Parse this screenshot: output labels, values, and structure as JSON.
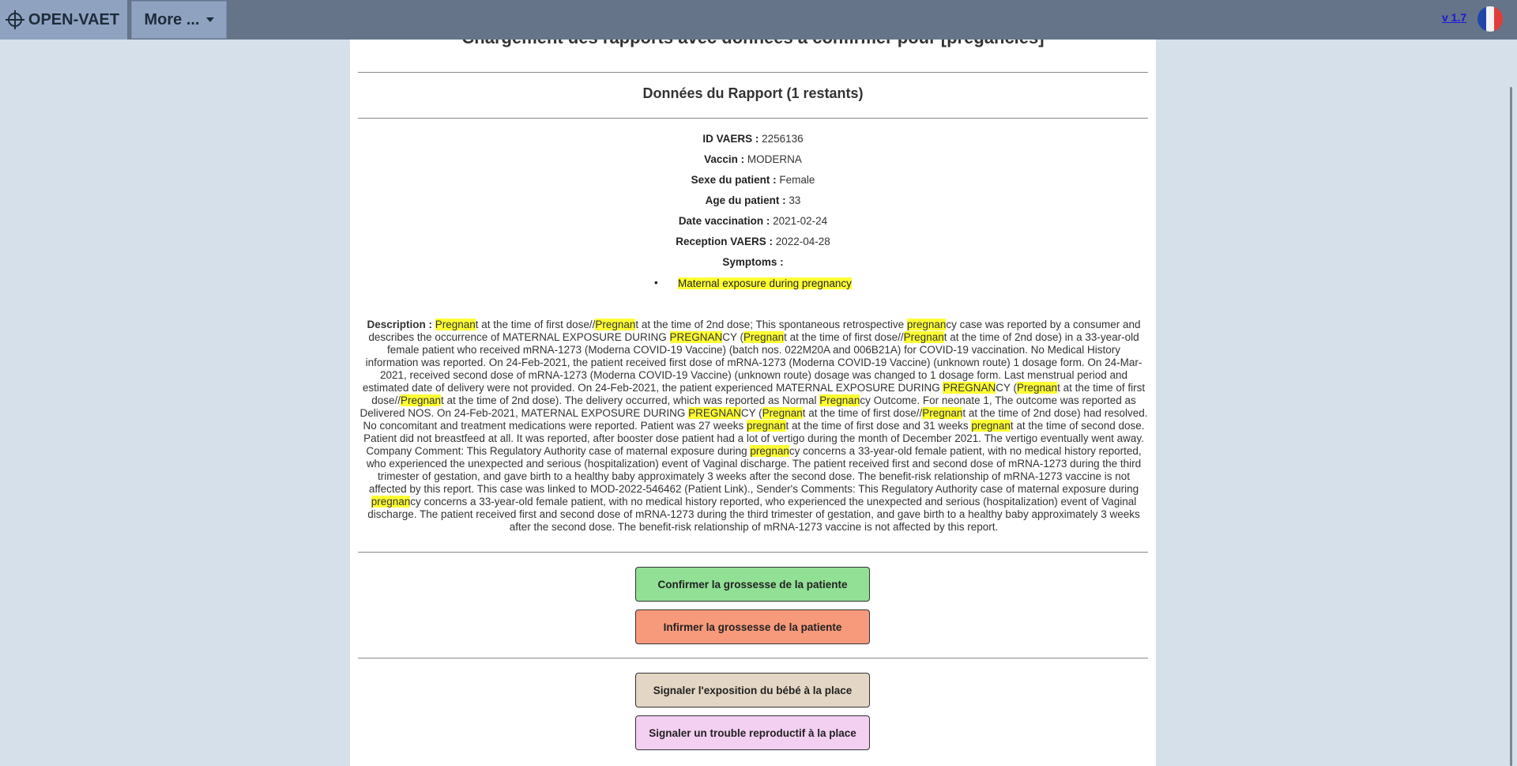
{
  "topbar": {
    "brand": "OPEN-VAET",
    "more_label": "More ...",
    "version": "v 1.7"
  },
  "main": {
    "loading_title": "Chargement des rapports avec données à confirmer pour [pregancies]",
    "section_title": "Données du Rapport (1 restants)",
    "fields": [
      {
        "label": "ID VAERS :",
        "value": "2256136"
      },
      {
        "label": "Vaccin :",
        "value": "MODERNA"
      },
      {
        "label": "Sexe du patient :",
        "value": "Female"
      },
      {
        "label": "Age du patient :",
        "value": "33"
      },
      {
        "label": "Date vaccination :",
        "value": "2021-02-24"
      },
      {
        "label": "Reception VAERS :",
        "value": "2022-04-28"
      },
      {
        "label": "Symptoms :",
        "value": ""
      }
    ],
    "symptoms": [
      "Maternal exposure during pregnancy"
    ],
    "description_label": "Description :",
    "description": "Pregnant at the time of first dose//Pregnant at the time of 2nd dose; This spontaneous retrospective pregnancy case was reported by a consumer and describes the occurrence of MATERNAL EXPOSURE DURING PREGNANCY (Pregnant at the time of first dose//Pregnant at the time of 2nd dose) in a 33-year-old female patient who received mRNA-1273 (Moderna COVID-19 Vaccine) (batch nos. 022M20A and 006B21A) for COVID-19 vaccination. No Medical History information was reported. On 24-Feb-2021, the patient received first dose of mRNA-1273 (Moderna COVID-19 Vaccine) (unknown route) 1 dosage form. On 24-Mar-2021, received second dose of mRNA-1273 (Moderna COVID-19 Vaccine) (unknown route) dosage was changed to 1 dosage form. Last menstrual period and estimated date of delivery were not provided. On 24-Feb-2021, the patient experienced MATERNAL EXPOSURE DURING PREGNANCY (Pregnant at the time of first dose//Pregnant at the time of 2nd dose). The delivery occurred, which was reported as Normal Pregnancy Outcome. For neonate 1, The outcome was reported as Delivered NOS. On 24-Feb-2021, MATERNAL EXPOSURE DURING PREGNANCY (Pregnant at the time of first dose//Pregnant at the time of 2nd dose) had resolved. No concomitant and treatment medications were reported. Patient was 27 weeks pregnant at the time of first dose and 31 weeks pregnant at the time of second dose. Patient did not breastfeed at all. It was reported, after booster dose patient had a lot of vertigo during the month of December 2021. The vertigo eventually went away. Company Comment: This Regulatory Authority case of maternal exposure during pregnancy concerns a 33-year-old female patient, with no medical history reported, who experienced the unexpected and serious (hospitalization) event of Vaginal discharge. The patient received first and second dose of mRNA-1273 during the third trimester of gestation, and gave birth to a healthy baby approximately 3 weeks after the second dose. The benefit-risk relationship of mRNA-1273 vaccine is not affected by this report. This case was linked to MOD-2022-546462 (Patient Link)., Sender's Comments: This Regulatory Authority case of maternal exposure during pregnancy concerns a 33-year-old female patient, with no medical history reported, who experienced the unexpected and serious (hospitalization) event of Vaginal discharge. The patient received first and second dose of mRNA-1273 during the third trimester of gestation, and gave birth to a healthy baby approximately 3 weeks after the second dose. The benefit-risk relationship of mRNA-1273 vaccine is not affected by this report.",
    "highlight_term": "pregnan",
    "buttons": {
      "confirm": "Confirmer la grossesse de la patiente",
      "infirm": "Infirmer la grossesse de la patiente",
      "baby_exposure": "Signaler l'exposition du bébé à la place",
      "repro_trouble": "Signaler un trouble reproductif à la place"
    }
  },
  "colors": {
    "topbar": "#657489",
    "brand_bg": "#8fa3c1",
    "background": "#d5e0ea",
    "highlight": "#ffff33",
    "confirm": "#91e095",
    "infirm": "#f79a7c",
    "baby": "#e4d6c4",
    "repro": "#f3cff1"
  }
}
